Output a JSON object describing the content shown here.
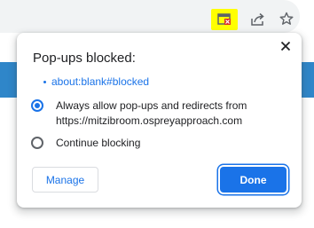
{
  "toolbar": {
    "icons": [
      "popup-blocked-icon",
      "share-icon",
      "bookmark-star-icon"
    ],
    "highlight_color": "#ffff00"
  },
  "popup": {
    "title": "Pop-ups blocked:",
    "blocked_items": [
      "about:blank#blocked"
    ],
    "options": [
      {
        "label": "Always allow pop-ups and redirects from https://mitzibroom.ospreyapproach.com",
        "selected": true
      },
      {
        "label": "Continue blocking",
        "selected": false
      }
    ],
    "manage_label": "Manage",
    "done_label": "Done",
    "close_icon": "close-icon"
  },
  "colors": {
    "accent": "#1a73e8",
    "text": "#202124",
    "page_strip": "#2f86c9"
  }
}
